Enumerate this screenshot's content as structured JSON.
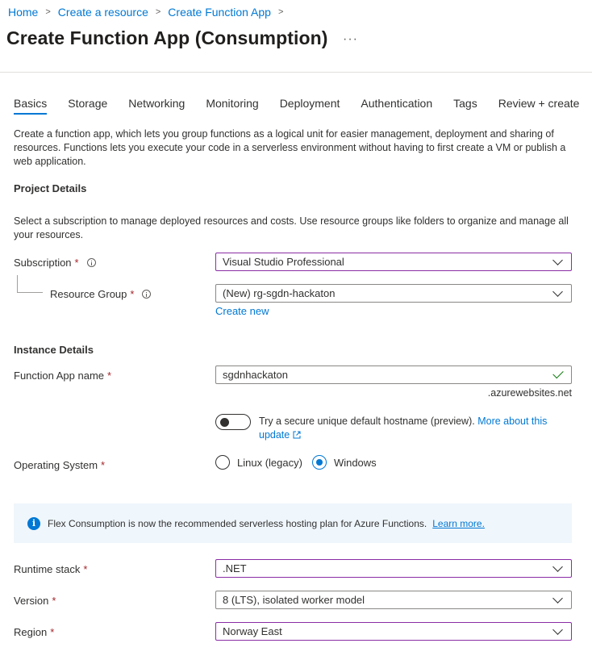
{
  "breadcrumb": {
    "items": [
      "Home",
      "Create a resource",
      "Create Function App"
    ],
    "separator": ">"
  },
  "page": {
    "title": "Create Function App (Consumption)",
    "more": "···"
  },
  "tabs": [
    "Basics",
    "Storage",
    "Networking",
    "Monitoring",
    "Deployment",
    "Authentication",
    "Tags",
    "Review + create"
  ],
  "active_tab": "Basics",
  "intro": "Create a function app, which lets you group functions as a logical unit for easier management, deployment and sharing of resources. Functions lets you execute your code in a serverless environment without having to first create a VM or publish a web application.",
  "project": {
    "heading": "Project Details",
    "description": "Select a subscription to manage deployed resources and costs. Use resource groups like folders to organize and manage all your resources.",
    "subscription_label": "Subscription",
    "subscription_value": "Visual Studio Professional",
    "resource_group_label": "Resource Group",
    "resource_group_value": "(New) rg-sgdn-hackaton",
    "create_new": "Create new"
  },
  "instance": {
    "heading": "Instance Details",
    "app_name_label": "Function App name",
    "app_name_value": "sgdnhackaton",
    "domain_suffix": ".azurewebsites.net",
    "hostname_text": "Try a secure unique default hostname (preview).",
    "hostname_link_1": "More about this",
    "hostname_link_2": "update",
    "os_label": "Operating System",
    "os_options": [
      "Linux (legacy)",
      "Windows"
    ],
    "os_selected": "Windows"
  },
  "banner": {
    "text": "Flex Consumption is now the recommended serverless hosting plan for Azure Functions.",
    "link": "Learn more."
  },
  "runtime": {
    "stack_label": "Runtime stack",
    "stack_value": ".NET",
    "version_label": "Version",
    "version_value": "8 (LTS), isolated worker model",
    "region_label": "Region",
    "region_value": "Norway East"
  },
  "required_marker": "*",
  "colors": {
    "accent": "#0078d4",
    "required": "#a4262c",
    "focus_border": "#8a2da5",
    "valid": "#107c10",
    "banner_bg": "#eff6fc"
  }
}
